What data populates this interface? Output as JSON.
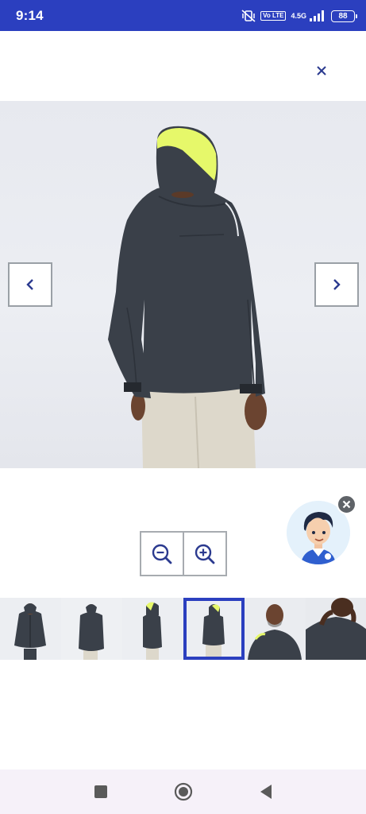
{
  "status_bar": {
    "time": "9:14",
    "network_badge": "Vo LTE",
    "network_type": "4.5G",
    "battery": "88",
    "icons": [
      "mute-vibrate-icon",
      "volte-icon",
      "signal-icon",
      "battery-icon"
    ]
  },
  "viewer": {
    "close_icon": "close-icon",
    "prev_icon": "chevron-left-icon",
    "next_icon": "chevron-right-icon",
    "zoom_out_icon": "zoom-out-icon",
    "zoom_in_icon": "zoom-in-icon",
    "active_thumbnail": 4,
    "thumbnail_count": 6
  },
  "assistant": {
    "avatar_icon": "chat-assistant-avatar",
    "dismiss_icon": "close-icon"
  },
  "nav_bar": {
    "icons": [
      "recents-square-icon",
      "home-circle-icon",
      "back-triangle-icon"
    ]
  },
  "colors": {
    "accent": "#2b3fbf",
    "jacket": "#3a4049",
    "hood_lining": "#e6f86a",
    "trousers": "#ddd8cb",
    "skin": "#6b4430"
  }
}
